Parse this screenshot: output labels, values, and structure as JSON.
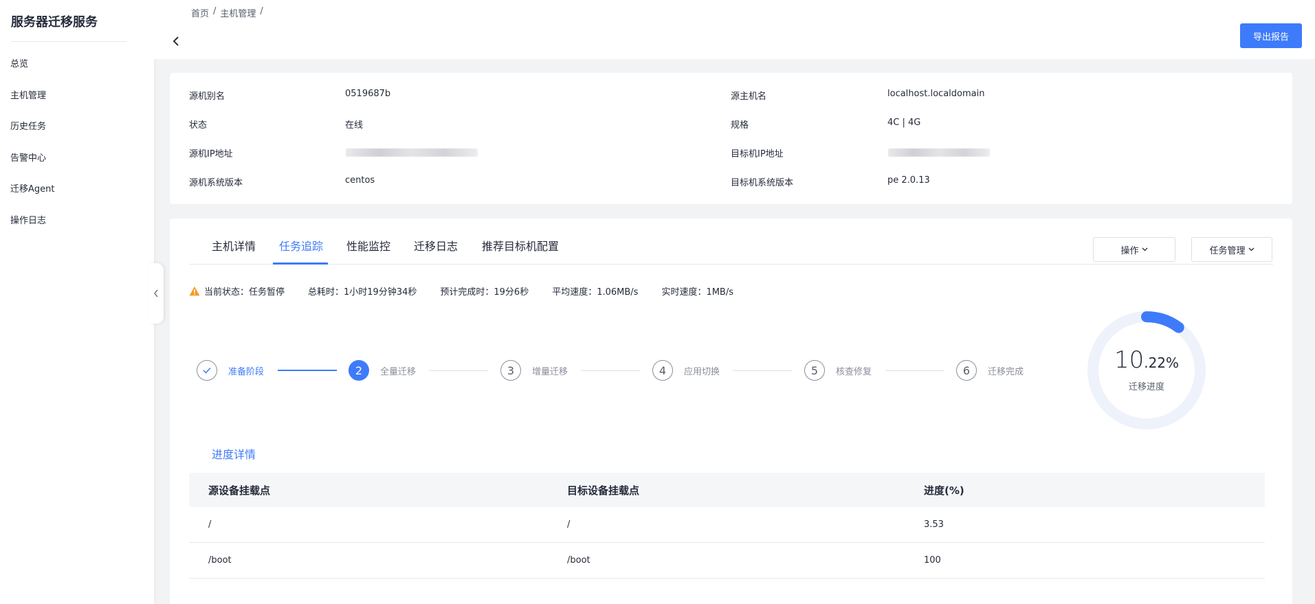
{
  "sidebar": {
    "title": "服务器迁移服务",
    "items": [
      {
        "label": "总览"
      },
      {
        "label": "主机管理"
      },
      {
        "label": "历史任务"
      },
      {
        "label": "告警中心"
      },
      {
        "label": "迁移Agent"
      },
      {
        "label": "操作日志"
      }
    ]
  },
  "header": {
    "breadcrumb": [
      "首页",
      "/",
      "主机管理",
      "/"
    ],
    "back_icon": "chevron-left-icon",
    "export_label": "导出报告"
  },
  "info": {
    "source_alias_label": "源机别名",
    "source_alias": "0519687b",
    "source_host_label": "源主机名",
    "source_host": "localhost.localdomain",
    "status_label": "状态",
    "status": "在线",
    "spec_label": "规格",
    "spec": "4C | 4G",
    "source_ip_label": "源机IP地址",
    "target_ip_label": "目标机IP地址",
    "source_os_label": "源机系统版本",
    "source_os": "centos",
    "target_os_label": "目标机系统版本",
    "target_os": "pe 2.0.13"
  },
  "tabs": [
    {
      "label": "主机详情"
    },
    {
      "label": "任务追踪"
    },
    {
      "label": "性能监控"
    },
    {
      "label": "迁移日志"
    },
    {
      "label": "推荐目标机配置"
    }
  ],
  "actions": {
    "operate_label": "操作",
    "task_manage_label": "任务管理"
  },
  "status_line": {
    "current": "当前状态：任务暂停",
    "total_time": "总耗时：1小时19分钟34秒",
    "eta": "预计完成时：19分6秒",
    "avg_speed": "平均速度：1.06MB/s",
    "realtime_speed": "实时速度：1MB/s"
  },
  "steps": [
    {
      "num": "✓",
      "label": "准备阶段",
      "state": "done"
    },
    {
      "num": "2",
      "label": "全量迁移",
      "state": "active"
    },
    {
      "num": "3",
      "label": "增量迁移",
      "state": "todo"
    },
    {
      "num": "4",
      "label": "应用切换",
      "state": "todo"
    },
    {
      "num": "5",
      "label": "核查修复",
      "state": "todo"
    },
    {
      "num": "6",
      "label": "迁移完成",
      "state": "todo"
    }
  ],
  "progress": {
    "int_part": "10",
    "dec_part": ".22%",
    "value": 0.1022,
    "label": "迁移进度",
    "color": "#3e7bfa",
    "track_color": "#eef2fb"
  },
  "sub_tab": {
    "label": "进度详情"
  },
  "table": {
    "headers": [
      "源设备挂载点",
      "目标设备挂载点",
      "进度(%)"
    ],
    "rows": [
      [
        "/",
        "/",
        "3.53"
      ],
      [
        "/boot",
        "/boot",
        "100"
      ]
    ]
  },
  "colors": {
    "accent": "#3e7bfa",
    "warning": "#f59a23"
  }
}
